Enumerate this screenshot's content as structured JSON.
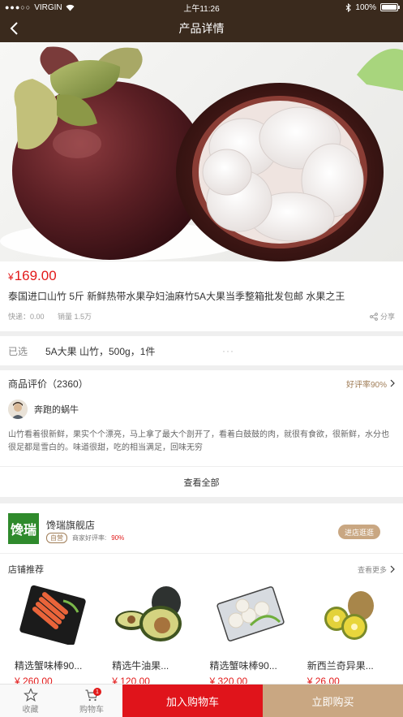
{
  "status_bar": {
    "carrier": "VIRGIN",
    "time": "上午11:26",
    "battery": "100%",
    "battery_level": 1.0
  },
  "nav": {
    "title": "产品详情"
  },
  "product": {
    "currency": "¥",
    "price": "169.00",
    "name": "泰国进口山竹 5斤 新鲜热带水果孕妇油麻竹5A大果当季整箱批发包邮 水果之王",
    "shipping": "快递：0.00",
    "sales": "销量 1.5万",
    "share": "分享"
  },
  "selection": {
    "label": "已选",
    "value": "5A大果 山竹，500g，1件",
    "more": "···"
  },
  "reviews": {
    "title": "商品评价（2360）",
    "rate": "好评率90%",
    "reviewer": "奔跑的蜗牛",
    "text": "山竹看着很新鲜，果实个个漂亮，马上拿了最大个剖开了，看着白鼓鼓的肉，就很有食欲，很新鲜，水分也很足都是雪白的。味道很甜，吃的相当满足，回味无穷",
    "view_all": "查看全部"
  },
  "store": {
    "logo": "馋瑞",
    "name": "馋瑞旗舰店",
    "tag": "自营",
    "rate_label": "商家好评率:",
    "rate": "90%",
    "visit": "进店逛逛"
  },
  "recommend": {
    "title": "店铺推荐",
    "more": "查看更多",
    "items": [
      {
        "name": "精选蟹味棒90...",
        "price": "¥ 260.00"
      },
      {
        "name": "精选牛油果...",
        "price": "¥ 120.00"
      },
      {
        "name": "精选蟹味棒90...",
        "price": "¥ 320.00"
      },
      {
        "name": "新西兰奇异果...",
        "price": "¥ 26.00"
      }
    ]
  },
  "bottom_bar": {
    "favorite": "收藏",
    "cart": "购物车",
    "cart_badge": "1",
    "add_to_cart": "加入购物车",
    "buy_now": "立即购买"
  },
  "colors": {
    "brand_dark": "#3a2a1d",
    "price_red": "#e21a1a",
    "gold": "#c9a782"
  }
}
